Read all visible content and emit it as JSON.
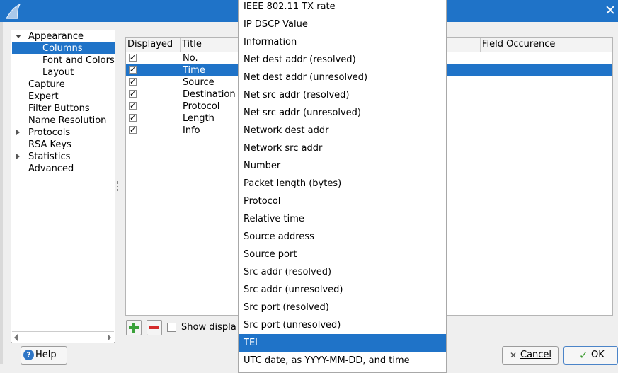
{
  "window": {
    "close_glyph": "✕",
    "accent": "#1f73c8",
    "icon": "wireshark-fin-icon"
  },
  "tree": {
    "items": [
      {
        "label": "Appearance",
        "expander": "expanded"
      },
      {
        "label": "Columns",
        "selected": true
      },
      {
        "label": "Font and Colors"
      },
      {
        "label": "Layout"
      },
      {
        "label": "Capture"
      },
      {
        "label": "Expert"
      },
      {
        "label": "Filter Buttons"
      },
      {
        "label": "Name Resolution"
      },
      {
        "label": "Protocols",
        "expander": "collapsed"
      },
      {
        "label": "RSA Keys"
      },
      {
        "label": "Statistics",
        "expander": "collapsed"
      },
      {
        "label": "Advanced"
      }
    ]
  },
  "table": {
    "headers": {
      "displayed": "Displayed",
      "title": "Title",
      "occurrence": "Field Occurence"
    },
    "rows": [
      {
        "title": "No.",
        "checked": true
      },
      {
        "title": "Time",
        "checked": true,
        "selected": true
      },
      {
        "title": "Source",
        "checked": true
      },
      {
        "title": "Destination",
        "checked": true
      },
      {
        "title": "Protocol",
        "checked": true
      },
      {
        "title": "Length",
        "checked": true
      },
      {
        "title": "Info",
        "checked": true
      }
    ],
    "check_glyph": "✓"
  },
  "controls": {
    "add_glyph": "+",
    "show_label": "Show displa",
    "help_label": "Help",
    "help_glyph": "?",
    "cancel_label": "Cancel",
    "cancel_glyph": "✕",
    "ok_label": "OK",
    "ok_glyph": "✓"
  },
  "menu": {
    "items": [
      "IEEE 802.11 TX rate",
      "IP DSCP Value",
      "Information",
      "Net dest addr (resolved)",
      "Net dest addr (unresolved)",
      "Net src addr (resolved)",
      "Net src addr (unresolved)",
      "Network dest addr",
      "Network src addr",
      "Number",
      "Packet length (bytes)",
      "Protocol",
      "Relative time",
      "Source address",
      "Source port",
      "Src addr (resolved)",
      "Src addr (unresolved)",
      "Src port (resolved)",
      "Src port (unresolved)",
      "TEI",
      "UTC date, as YYYY-MM-DD, and time"
    ],
    "selected": "TEI"
  }
}
